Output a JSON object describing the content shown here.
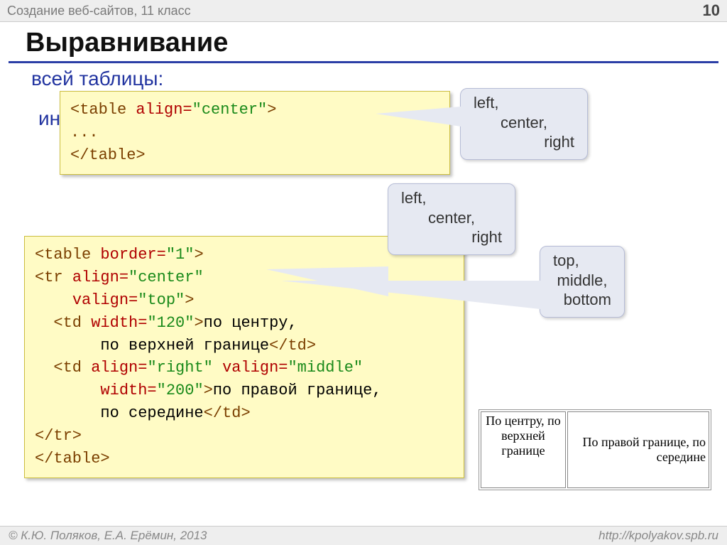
{
  "header": {
    "topic": "Создание веб-сайтов, 11 класс",
    "page": "10"
  },
  "title": "Выравнивание",
  "sec1": {
    "heading": "всей таблицы:"
  },
  "sec2": {
    "heading": "информации в ячейках:"
  },
  "code1": {
    "l1a": "<table ",
    "l1b": "align=",
    "l1c": "\"center\"",
    "l1d": ">",
    "l2": "...",
    "l3": "</table>"
  },
  "code2": {
    "l1a": "<table ",
    "l1b": "border=",
    "l1c": "\"1\"",
    "l1d": ">",
    "l2a": "<tr ",
    "l2b": "align=",
    "l2c": "\"center\"",
    "l3a": "    ",
    "l3b": "valign=",
    "l3c": "\"top\"",
    "l3d": ">",
    "l4a": "  <td ",
    "l4b": "width=",
    "l4c": "\"120\"",
    "l4d": ">",
    "l4e": "по центру,",
    "l5a": "       по верхней границе",
    "l5b": "</td>",
    "l6a": "  <td ",
    "l6b": "align=",
    "l6c": "\"right\" ",
    "l6d": "valign=",
    "l6e": "\"middle\"",
    "l7a": "       ",
    "l7b": "width=",
    "l7c": "\"200\"",
    "l7d": ">",
    "l7e": "по правой границе,",
    "l8a": "       по середине",
    "l8b": "</td>",
    "l9": "</tr>",
    "l10": "</table>"
  },
  "callouts": {
    "a": {
      "l1": "left,",
      "l2": "center,",
      "l3": "right"
    },
    "b": {
      "l1": "left,",
      "l2": "center,",
      "l3": "right"
    },
    "c": {
      "l1": "top,",
      "l2": "middle,",
      "l3": "bottom"
    }
  },
  "demo": {
    "cell1": "По центру, по верхней границе",
    "cell2": "По правой границе, по середине"
  },
  "footer": {
    "left": "© К.Ю. Поляков, Е.А. Ерёмин, 2013",
    "right": "http://kpolyakov.spb.ru"
  }
}
